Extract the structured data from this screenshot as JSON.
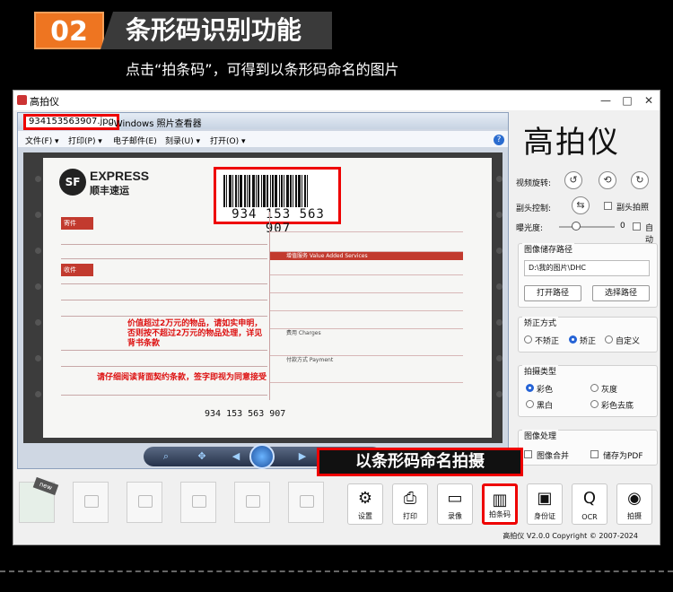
{
  "header": {
    "number": "02",
    "title": "条形码识别功能",
    "subtitle": "点击“拍条码”，可得到以条形码命名的图片"
  },
  "window": {
    "title": "高拍仪",
    "controls": [
      "—",
      "□",
      "✕"
    ]
  },
  "viewer": {
    "filename": "934153563907.jpg",
    "app_title": "- Windows 照片查看器",
    "menu": [
      "文件(F) ▾",
      "打印(P) ▾",
      "电子邮件(E)",
      "刻录(U) ▾",
      "打开(O) ▾"
    ],
    "help": "?"
  },
  "document": {
    "brand_en": "EXPRESS",
    "brand_cn": "顺丰速运",
    "logo": "SF",
    "barcode_number": "934 153 563 907",
    "bottom_number": "934 153 563 907",
    "section_sender": "寄件",
    "section_receiver": "收件",
    "warning1": "价值超过2万元的物品，请如实申明，否则按不超过2万元的物品处理，详见背书条款",
    "warning2": "请仔细阅读背面契约条款，签字即视为同意接受",
    "value_service": "增值服务 Value Added Services",
    "fee": "费用 Charges",
    "payment": "付款方式 Payment"
  },
  "capture_label": "以条形码命名拍摄",
  "panel": {
    "title": "高拍仪",
    "rotate_label": "视频旋转:",
    "rotate_icons": [
      "↺",
      "⟲",
      "↻"
    ],
    "head_label": "副头控制:",
    "head_shoot": "副头拍照",
    "exposure_label": "曝光度:",
    "exposure_value": "0",
    "exposure_level": 0.3,
    "auto": "自动",
    "path_group": "图像储存路径",
    "path_value": "D:\\我的图片\\DHC",
    "open_path": "打开路径",
    "choose_path": "选择路径",
    "correct_group": "矫正方式",
    "correct_options": [
      "不矫正",
      "矫正",
      "自定义"
    ],
    "correct_selected": 1,
    "shoot_group": "拍摄类型",
    "shoot_options": [
      "彩色",
      "灰度",
      "黑白",
      "彩色去底"
    ],
    "shoot_selected": 0,
    "process_group": "图像处理",
    "merge": "图像合并",
    "save_pdf": "储存为PDF"
  },
  "thumbs": {
    "new_tag": "new"
  },
  "toolbar": [
    {
      "label": "设置",
      "icon": "⚙"
    },
    {
      "label": "打印",
      "icon": "⎙"
    },
    {
      "label": "录像",
      "icon": "▭"
    },
    {
      "label": "拍条码",
      "icon": "▥"
    },
    {
      "label": "身份证",
      "icon": "▣"
    },
    {
      "label": "OCR",
      "icon": "Q"
    },
    {
      "label": "拍摄",
      "icon": "◉"
    }
  ],
  "copyright": "高拍仪 V2.0.0 Copyright © 2007-2024"
}
